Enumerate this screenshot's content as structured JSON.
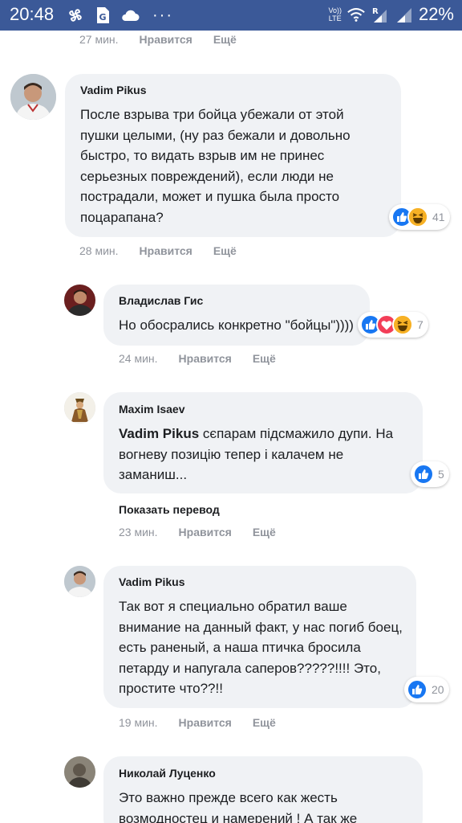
{
  "status_bar": {
    "time": "20:48",
    "volte_top": "Vo))",
    "volte_bottom": "LTE",
    "battery": "22%",
    "dots": "···",
    "icons": [
      "pinwheel-icon",
      "sim-g-icon",
      "cloud-icon",
      "wifi-icon",
      "signal-r-icon",
      "signal-icon"
    ]
  },
  "top_meta": {
    "time": "27 мин.",
    "like": "Нравится",
    "more": "Ещё"
  },
  "comments": [
    {
      "author": "Vadim Pikus",
      "text": [
        "После взрыва три бойца убежали от этой",
        "пушки целыми, (ну раз бежали и довольно",
        "быстро, то видать взрыв им не принес",
        "серьезных повреждений), если люди не",
        "пострадали, может и пушка была просто",
        "поцарапана?"
      ],
      "reactions": {
        "types": [
          "like",
          "haha"
        ],
        "count": "41"
      },
      "time": "28 мин.",
      "like": "Нравится",
      "more": "Ещё"
    },
    {
      "author": "Владислав Гис",
      "text": [
        "Но обосрались конкретно \"бойцы\"))))"
      ],
      "reactions": {
        "types": [
          "like",
          "love",
          "haha"
        ],
        "count": "7"
      },
      "time": "24 мин.",
      "like": "Нравится",
      "more": "Ещё"
    },
    {
      "author": "Maxim Isaev",
      "mention": "Vadim Pikus",
      "text": [
        " сєпарам підсмажило дупи. На",
        "вогневу позицію тепер і калачем не",
        "заманиш..."
      ],
      "reactions": {
        "types": [
          "like"
        ],
        "count": "5"
      },
      "translate": "Показать перевод",
      "time": "23 мин.",
      "like": "Нравится",
      "more": "Ещё"
    },
    {
      "author": "Vadim Pikus",
      "text": [
        "Так вот я специально обратил ваше",
        "внимание на данный факт, у нас погиб боец,",
        "есть раненый, а наша птичка бросила",
        "петарду и напугала саперов?????!!!! Это,",
        "простите что??!!"
      ],
      "reactions": {
        "types": [
          "like"
        ],
        "count": "20"
      },
      "time": "19 мин.",
      "like": "Нравится",
      "more": "Ещё"
    },
    {
      "author": "Николай Луценко",
      "text": [
        "Это важно прежде всего как жесть",
        "возмодностец и намерений ! А так же"
      ]
    }
  ],
  "colors": {
    "status_bar": "#3b5998",
    "bubble": "#f0f2f5",
    "like_blue": "#1877f2",
    "love_red": "#f33e58",
    "haha_yellow": "#f7b125",
    "meta_grey": "#90949c"
  }
}
